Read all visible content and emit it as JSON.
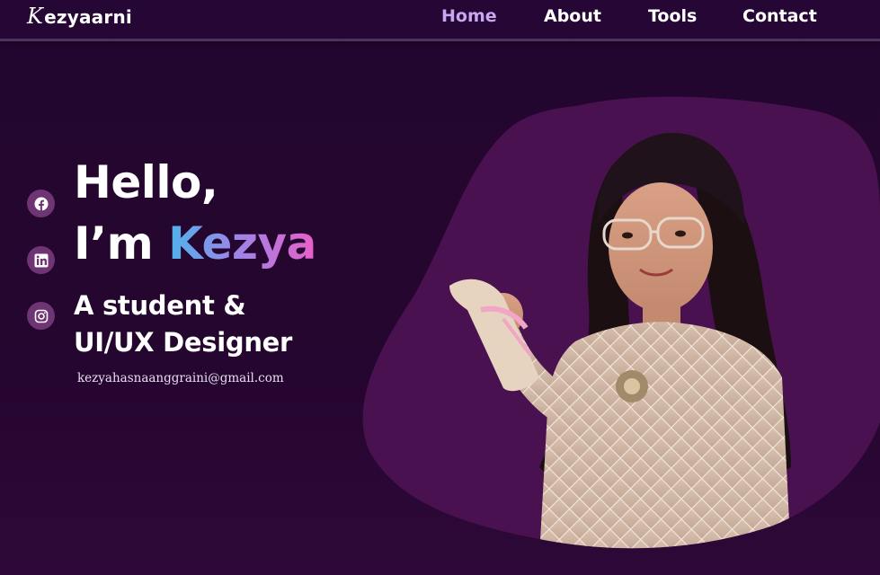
{
  "brand": {
    "logo_initial": "K",
    "logo_rest": "ezyaarni"
  },
  "nav": {
    "items": [
      {
        "label": "Home",
        "active": true
      },
      {
        "label": "About",
        "active": false
      },
      {
        "label": "Tools",
        "active": false
      },
      {
        "label": "Contact",
        "active": false
      }
    ]
  },
  "social": [
    {
      "icon": "facebook-icon"
    },
    {
      "icon": "linkedin-icon"
    },
    {
      "icon": "instagram-icon"
    }
  ],
  "hero": {
    "greeting": "Hello,",
    "intro_prefix": "I’m ",
    "name": "Kezya",
    "role_line1": "A student &",
    "role_line2": "UI/UX Designer",
    "email": "kezyahasnaanggraini@gmail.com"
  },
  "colors": {
    "background": "#24062f",
    "nav_active": "#c9a6f0",
    "blob": "#4a1150",
    "social_circle": "#6e3474",
    "name_gradient": [
      "#4fb3ea",
      "#9b86e8",
      "#e85fc8"
    ]
  }
}
